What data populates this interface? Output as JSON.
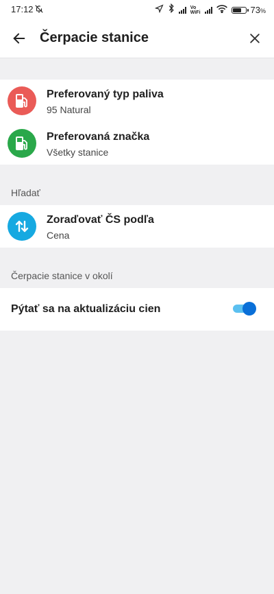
{
  "status_bar": {
    "time": "17:12",
    "vowifi_top": "Vo",
    "vowifi_bottom": "WiFi",
    "battery_percent": "73",
    "battery_percent_suffix": "%",
    "battery_level": 0.73
  },
  "header": {
    "title": "Čerpacie stanice",
    "back_icon": "arrow-back-icon",
    "close_icon": "close-icon"
  },
  "preferences": [
    {
      "title": "Preferovaný typ paliva",
      "subtitle": "95 Natural",
      "icon": "fuel-pump-icon",
      "color": "#ea5b57"
    },
    {
      "title": "Preferovaná značka",
      "subtitle": "Všetky stanice",
      "icon": "fuel-pump-icon",
      "color": "#2aa84a"
    }
  ],
  "search_section": {
    "label": "Hľadať",
    "sort": {
      "title": "Zoraďovať ČS podľa",
      "subtitle": "Cena",
      "icon": "sort-arrows-icon",
      "color": "#16a9e1"
    }
  },
  "nearby_section": {
    "label": "Čerpacie stanice v okolí",
    "toggle_label": "Pýtať sa na aktualizáciu cien",
    "toggle_on": true,
    "toggle_color": "#0a6fd8"
  }
}
